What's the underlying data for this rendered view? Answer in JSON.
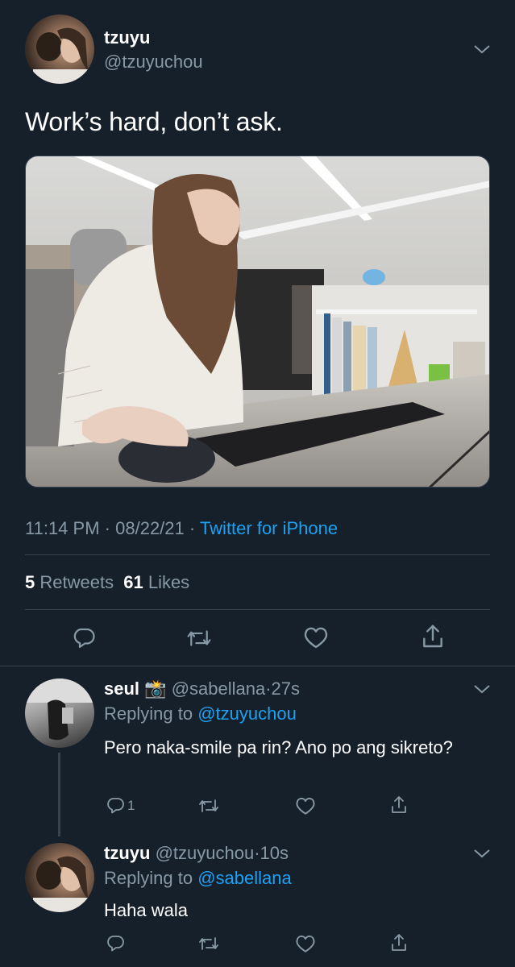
{
  "tweet": {
    "display_name": "tzuyu",
    "handle": "@tzuyuchou",
    "text": "Work’s hard, don’t ask.",
    "time": "11:14 PM",
    "date": "08/22/21",
    "source": "Twitter for iPhone",
    "retweets_count": "5",
    "retweets_label": "Retweets",
    "likes_count": "61",
    "likes_label": "Likes",
    "separator": "·"
  },
  "replies": [
    {
      "display_name": "seul",
      "emoji": "📸",
      "handle": "@sabellana",
      "time": "27s",
      "replying_prefix": "Replying to",
      "replying_to": "@tzuyuchou",
      "text": "Pero naka-smile pa rin? Ano po ang sikreto?",
      "reply_count": "1"
    },
    {
      "display_name": "tzuyu",
      "handle": "@tzuyuchou",
      "time": "10s",
      "replying_prefix": "Replying to",
      "replying_to": "@sabellana",
      "text": "Haha wala"
    }
  ],
  "colors": {
    "background": "#15202b",
    "text": "#ffffff",
    "muted": "#8899a6",
    "link": "#1da1f2",
    "divider": "#38444d"
  },
  "icons": [
    "chevron-down-icon",
    "reply-icon",
    "retweet-icon",
    "like-icon",
    "share-icon",
    "camera-flash-emoji"
  ]
}
